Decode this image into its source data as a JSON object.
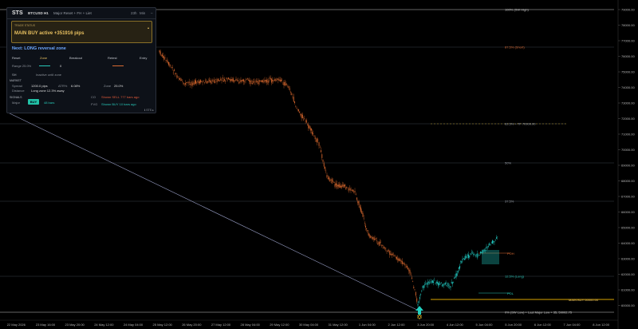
{
  "window": {
    "title": "STS",
    "symbol": "BTCUSD H1",
    "mode": "Major Reset + FH + Liet",
    "btn_a": "23h",
    "btn_b": "Min",
    "btn_close": "–"
  },
  "signal": {
    "label": "TRADE STATUS",
    "text": "MAIN BUY active +351916 pips",
    "chevron": "▴"
  },
  "next": {
    "title": "Next: LONG reversal zone",
    "stages": [
      "Reset",
      "Zone",
      "Breakout",
      "Retest",
      "Entry"
    ],
    "range_label": "Range 25.0%",
    "range_value": "0"
  },
  "sh": {
    "label": "SH",
    "value": "Inactive until zone"
  },
  "market": {
    "heading": "MARKET",
    "spread_label": "Spread",
    "spread_value": "1200.0 pips",
    "atr_label": "ATR%",
    "atr_value": "6.08%",
    "zone_label": "Zone",
    "zone_value": "25.0%",
    "distance_label": "Distance",
    "distance_value": "Long zone 12.3% away"
  },
  "details": {
    "heading": "SIGNALS",
    "major_label": "Major",
    "major_badge": "BUY",
    "major_bars": "48 bars",
    "co_label": "CO",
    "co_value": "Shown SELL 777 bars ago",
    "fvg_label": "FVG",
    "fvg_value": "Shown BUY 10 bars ago"
  },
  "footer": "ℹ STS ▸",
  "levels": {
    "l100": "100% (SW High)",
    "l875": "87.5% (Short)",
    "l625": "62.5% + TF 70900.00",
    "l50": "50%",
    "l375": "37.5%",
    "poh": "POH",
    "l125": "12.5% (Long)",
    "pol": "POL",
    "mainbuy": "MAIN BUY 60000.00",
    "l0": "0% (SW Low) + Last Major Low + 35, 59002.75"
  },
  "y_axis": [
    "79000.00",
    "78000.00",
    "77000.00",
    "76000.00",
    "75000.00",
    "74000.00",
    "73000.00",
    "72000.00",
    "71000.00",
    "70000.00",
    "69000.00",
    "68000.00",
    "67000.00",
    "66000.00",
    "65000.00",
    "64000.00",
    "63000.00",
    "62000.00",
    "61000.00",
    "60000.00"
  ],
  "x_axis": [
    "22 May 2026",
    "23 May 16:00",
    "23 May 20:00",
    "24 May 12:00",
    "24 May 04:00",
    "25 May 12:00",
    "26 May 20:00",
    "27 May 12:00",
    "28 May 04:00",
    "29 May 12:00",
    "30 May 04:00",
    "31 May 12:00",
    "1 Jun 04:00",
    "2 Jun 12:00",
    "3 Jun 20:00",
    "4 Jun 12:00",
    "5 Jun 04:00",
    "5 Jun 20:00",
    "6 Jun 12:00",
    "7 Jun 04:00",
    "8 Jun 12:00"
  ],
  "colors": {
    "bear_candle": "#c8602a",
    "bull_candle": "#1fbfb8",
    "level_line": "#3a3f48",
    "mainbuy_line": "#d9a400",
    "accent_text": "#e8c060"
  }
}
